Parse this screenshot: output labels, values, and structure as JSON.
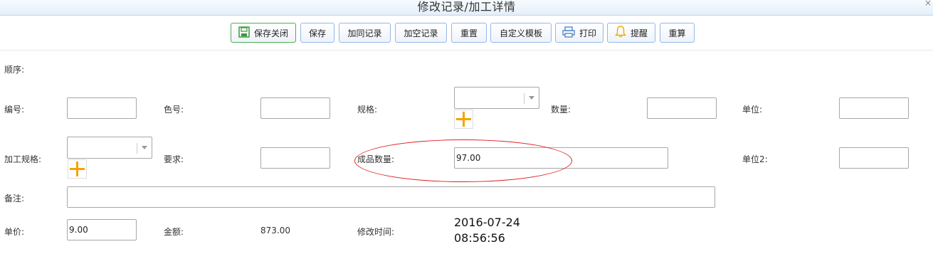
{
  "window": {
    "title": "修改记录/加工详情",
    "close_glyph": "×"
  },
  "toolbar": {
    "save_close": "保存关闭",
    "save": "保存",
    "add_same_record": "加同记录",
    "add_empty_record": "加空记录",
    "reset": "重置",
    "custom_template": "自定义模板",
    "print": "打印",
    "remind": "提醒",
    "recalculate": "重算"
  },
  "form": {
    "order_label": "顺序:",
    "number_label": "编号:",
    "number_value": "",
    "color_no_label": "色号:",
    "color_no_value": "",
    "spec_label": "规格:",
    "spec_value": "",
    "quantity_label": "数量:",
    "quantity_value": "",
    "unit_label": "单位:",
    "unit_value": "",
    "process_spec_label": "加工规格:",
    "process_spec_value": "",
    "requirement_label": "要求:",
    "requirement_value": "",
    "finished_qty_label": "成品数量:",
    "finished_qty_value": "97.00",
    "unit2_label": "单位2:",
    "unit2_value": "",
    "remark_label": "备注:",
    "remark_value": "",
    "price_label": "单价:",
    "price_value": "9.00",
    "amount_label": "金额:",
    "amount_value": "873.00",
    "modified_time_label": "修改时间:",
    "modified_date": "2016-07-24",
    "modified_clock": "08:56:56"
  },
  "colors": {
    "annotation": "#e02020",
    "plus_icon": "#f5a300",
    "button_border": "#95b8e7"
  }
}
